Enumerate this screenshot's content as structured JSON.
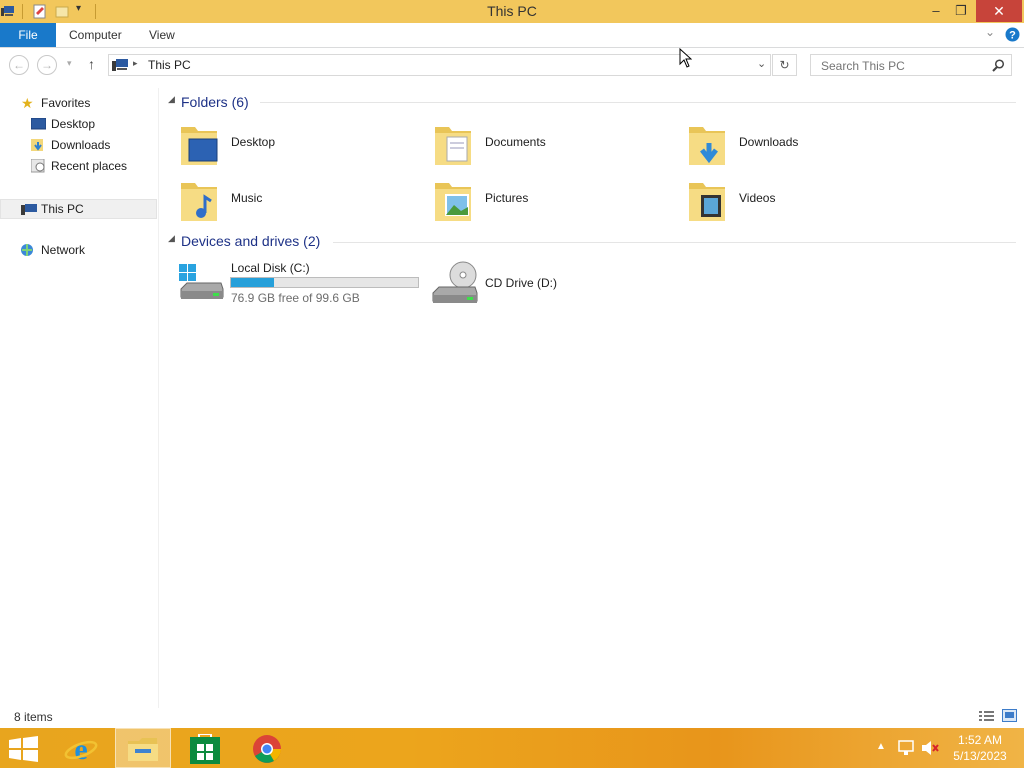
{
  "window": {
    "title": "This PC",
    "minimize": "–",
    "restore": "❐",
    "close": "✕"
  },
  "ribbon": {
    "tabs": [
      "File",
      "Computer",
      "View"
    ],
    "expand_icon": "chevron-down-icon",
    "help_icon": "help-icon"
  },
  "address": {
    "path": "This PC",
    "search_placeholder": "Search This PC"
  },
  "nav": {
    "favorites": "Favorites",
    "favorites_items": [
      "Desktop",
      "Downloads",
      "Recent places"
    ],
    "this_pc": "This PC",
    "network": "Network"
  },
  "content": {
    "folders_header": "Folders (6)",
    "folders": [
      "Desktop",
      "Documents",
      "Downloads",
      "Music",
      "Pictures",
      "Videos"
    ],
    "devices_header": "Devices and drives (2)",
    "drives": [
      {
        "name": "Local Disk (C:)",
        "free_text": "76.9 GB free of 99.6 GB",
        "used_fraction": 0.228
      },
      {
        "name": "CD Drive (D:)"
      }
    ]
  },
  "status": {
    "items": "8 items"
  },
  "taskbar": {
    "time": "1:52 AM",
    "date": "5/13/2023"
  },
  "colors": {
    "titlebar": "#f2c75c",
    "file_tab": "#1979ca",
    "close": "#c7443a",
    "group_header": "#1e3287",
    "drive_fill": "#26a0da",
    "taskbar": "#eca51c"
  }
}
